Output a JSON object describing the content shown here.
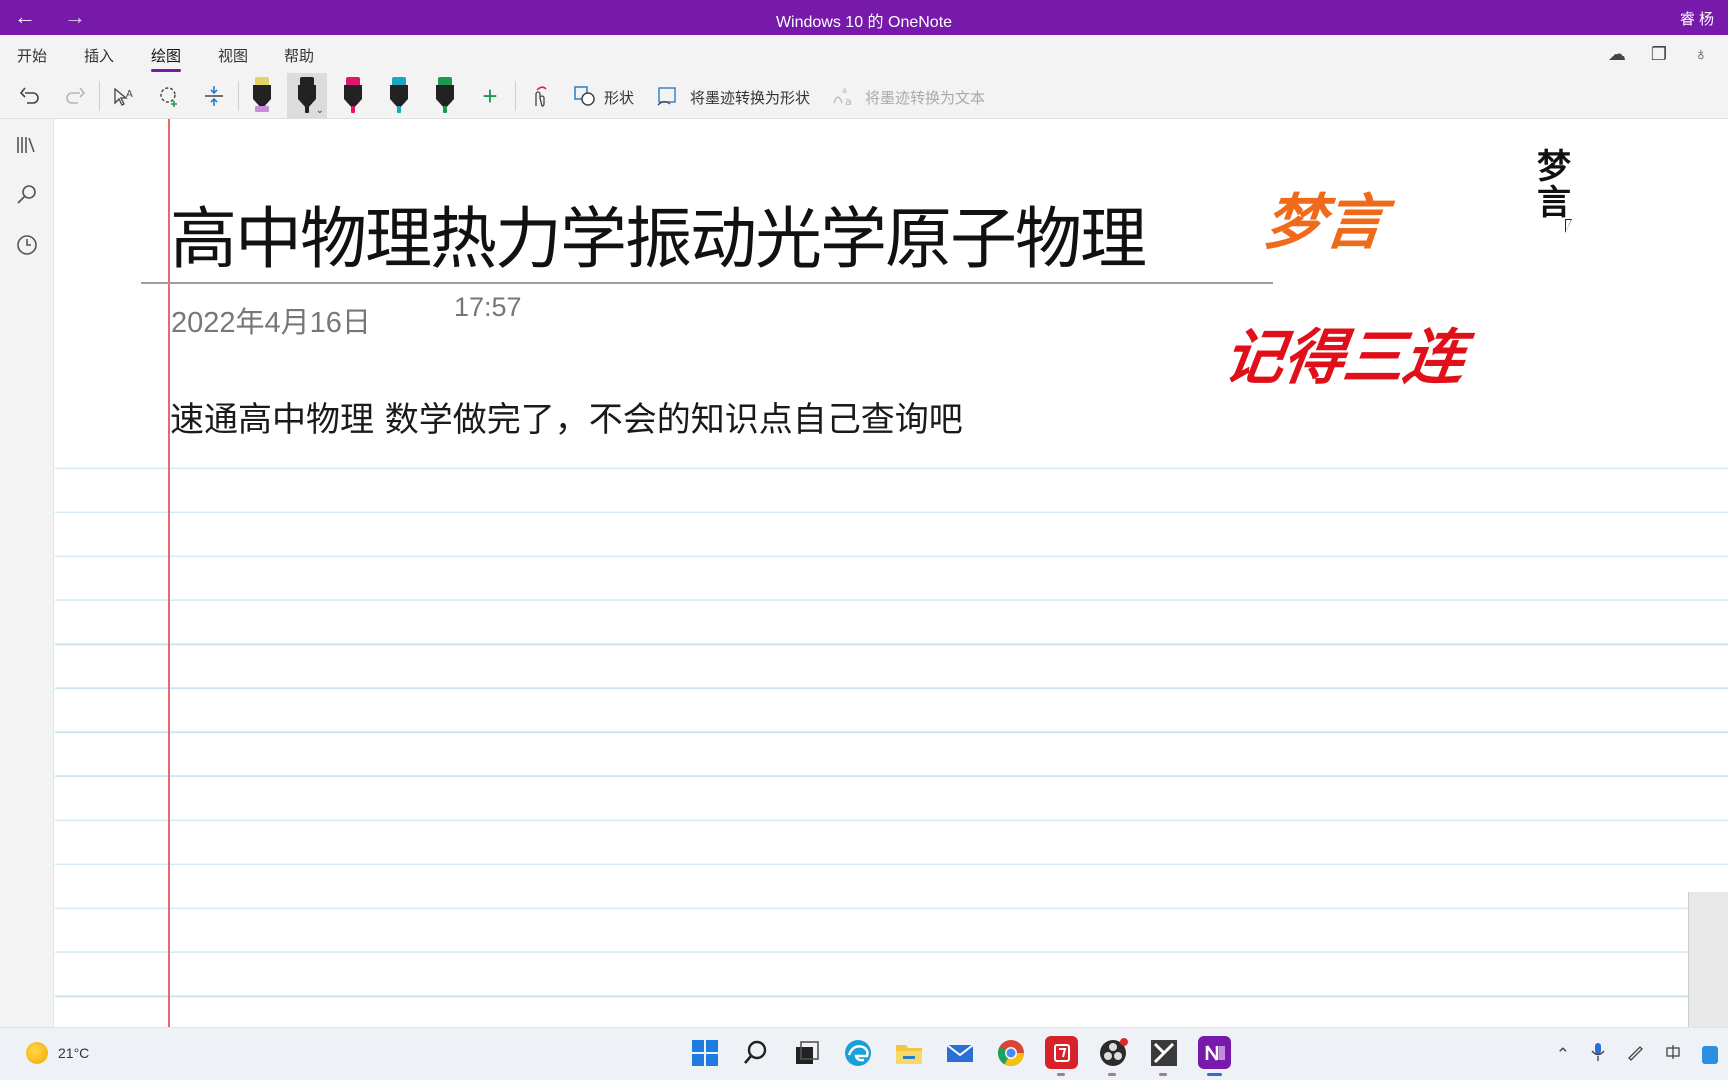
{
  "titlebar": {
    "title": "Windows 10 的 OneNote",
    "user": "睿 杨",
    "back_glyph": "←",
    "forward_glyph": "→"
  },
  "menu": {
    "items": [
      "开始",
      "插入",
      "绘图",
      "视图",
      "帮助"
    ],
    "active": "绘图"
  },
  "toolbar": {
    "shapes_label": "形状",
    "ink_to_shape_label": "将墨迹转换为形状",
    "ink_to_text_label": "将墨迹转换为文本",
    "pen_colors": [
      "#e5d06a",
      "#222222",
      "#e0156b",
      "#1aa5c8",
      "#1a9b4b"
    ],
    "pen_tip_colors": [
      "#c58ed6",
      "#222222",
      "#e0156b",
      "#1aa5c8",
      "#1a9b4b"
    ],
    "add_pen_glyph": "+"
  },
  "page": {
    "title": "高中物理热力学振动光学原子物理",
    "date": "2022年4月16日",
    "time": "17:57",
    "body": "速通高中物理 数学做完了，不会的知识点自己查询吧",
    "ink_orange": "梦言",
    "ink_red": "记得三连",
    "ink_black": "梦言"
  },
  "taskbar": {
    "weather": "21°C"
  }
}
